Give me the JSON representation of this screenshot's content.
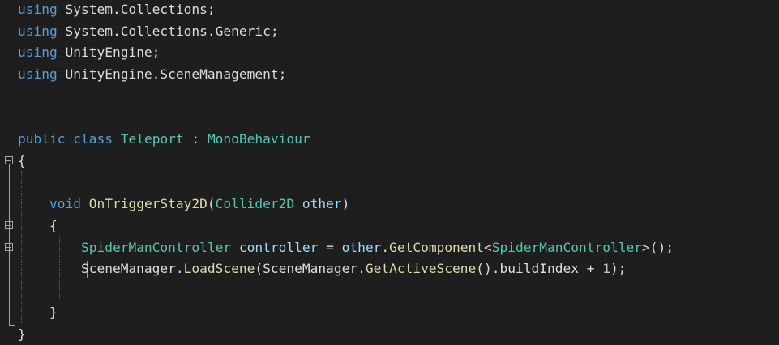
{
  "colors": {
    "background": "#1e1e1e",
    "keyword": "#569cd6",
    "type": "#4ec9b0",
    "method": "#dcdcaa",
    "identifier": "#9cdcfe",
    "plain": "#dcdcdc",
    "number": "#b5cea8"
  },
  "code": {
    "lines": [
      [
        {
          "t": "using",
          "c": "keyword"
        },
        {
          "t": " System.Collections;",
          "c": "plain"
        }
      ],
      [
        {
          "t": "using",
          "c": "keyword"
        },
        {
          "t": " System.Collections.Generic;",
          "c": "plain"
        }
      ],
      [
        {
          "t": "using",
          "c": "keyword"
        },
        {
          "t": " UnityEngine;",
          "c": "plain"
        }
      ],
      [
        {
          "t": "using",
          "c": "keyword"
        },
        {
          "t": " UnityEngine.SceneManagement;",
          "c": "plain"
        }
      ],
      [],
      [],
      [
        {
          "t": "public",
          "c": "keyword"
        },
        {
          "t": " ",
          "c": "plain"
        },
        {
          "t": "class",
          "c": "keyword"
        },
        {
          "t": " ",
          "c": "plain"
        },
        {
          "t": "Teleport",
          "c": "type"
        },
        {
          "t": " : ",
          "c": "plain"
        },
        {
          "t": "MonoBehaviour",
          "c": "type"
        }
      ],
      [
        {
          "t": "{",
          "c": "plain"
        }
      ],
      [],
      [
        {
          "t": "    ",
          "c": "plain"
        },
        {
          "t": "void",
          "c": "keyword"
        },
        {
          "t": " ",
          "c": "plain"
        },
        {
          "t": "OnTriggerStay2D",
          "c": "method"
        },
        {
          "t": "(",
          "c": "plain"
        },
        {
          "t": "Collider2D",
          "c": "type"
        },
        {
          "t": " ",
          "c": "plain"
        },
        {
          "t": "other",
          "c": "identifier"
        },
        {
          "t": ")",
          "c": "plain"
        }
      ],
      [
        {
          "t": "    {",
          "c": "plain"
        }
      ],
      [
        {
          "t": "        ",
          "c": "plain"
        },
        {
          "t": "SpiderManController",
          "c": "type"
        },
        {
          "t": " ",
          "c": "plain"
        },
        {
          "t": "controller",
          "c": "identifier"
        },
        {
          "t": " = ",
          "c": "plain"
        },
        {
          "t": "other",
          "c": "identifier"
        },
        {
          "t": ".",
          "c": "plain"
        },
        {
          "t": "GetComponent",
          "c": "method"
        },
        {
          "t": "<",
          "c": "plain"
        },
        {
          "t": "SpiderManController",
          "c": "type"
        },
        {
          "t": ">();",
          "c": "plain"
        }
      ],
      [
        {
          "t": "        SceneManager.",
          "c": "plain"
        },
        {
          "t": "LoadScene",
          "c": "method"
        },
        {
          "t": "(SceneManager.",
          "c": "plain"
        },
        {
          "t": "GetActiveScene",
          "c": "method"
        },
        {
          "t": "().buildIndex + ",
          "c": "plain"
        },
        {
          "t": "1",
          "c": "number"
        },
        {
          "t": ");",
          "c": "plain"
        }
      ],
      [],
      [
        {
          "t": "    }",
          "c": "plain"
        }
      ],
      [
        {
          "t": "}",
          "c": "plain"
        }
      ]
    ]
  }
}
